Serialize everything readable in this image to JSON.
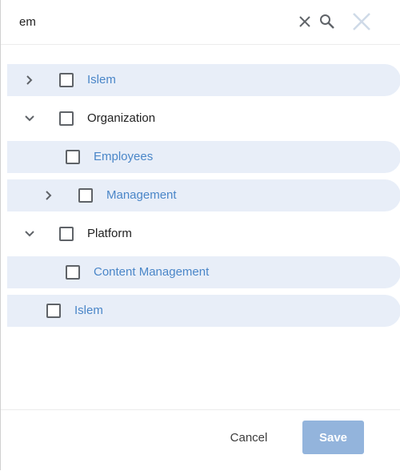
{
  "search": {
    "value": "em"
  },
  "icons": {
    "clear": "close-icon",
    "search": "search-icon",
    "close": "close-icon",
    "expand": "chevron-right-icon",
    "collapse": "chevron-down-icon"
  },
  "colors": {
    "highlight_row": "#e8eef8",
    "match_text": "#4a86c8",
    "save_button": "#93b4dc"
  },
  "tree": {
    "items": [
      {
        "label": "Islem",
        "highlighted": true,
        "chevron": "right"
      },
      {
        "label": "Organization",
        "highlighted": false,
        "chevron": "down"
      },
      {
        "label": "Employees",
        "highlighted": true,
        "chevron": "none"
      },
      {
        "label": "Management",
        "highlighted": true,
        "chevron": "right"
      },
      {
        "label": "Platform",
        "highlighted": false,
        "chevron": "down"
      },
      {
        "label": "Content Management",
        "highlighted": true,
        "chevron": "none"
      },
      {
        "label": "Islem",
        "highlighted": true,
        "chevron": "none"
      }
    ]
  },
  "footer": {
    "cancel_label": "Cancel",
    "save_label": "Save"
  }
}
